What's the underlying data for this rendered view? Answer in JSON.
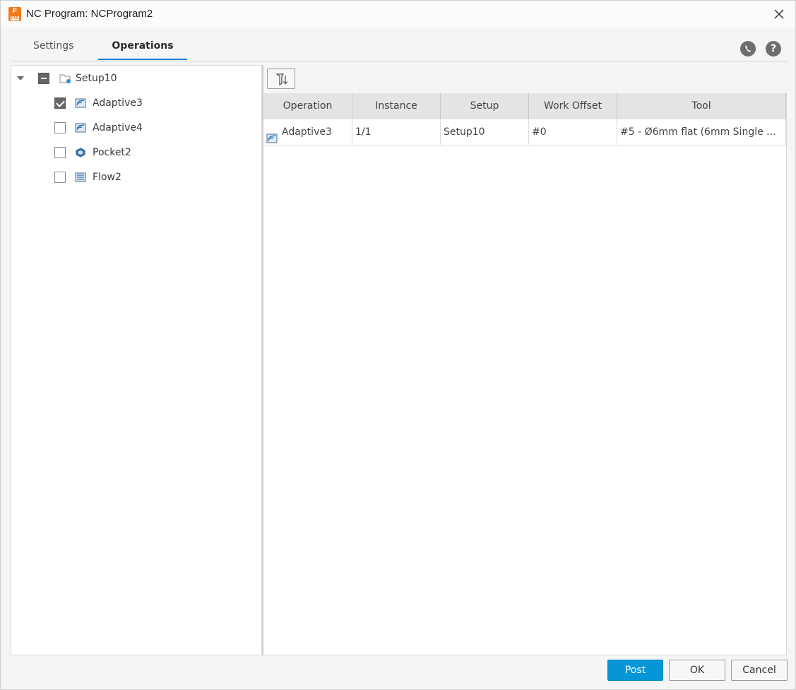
{
  "window": {
    "title": "NC Program: NCProgram2",
    "app_icon_letter": "F",
    "app_icon_sub": "FAB"
  },
  "tabs": [
    {
      "label": "Settings",
      "active": false
    },
    {
      "label": "Operations",
      "active": true
    }
  ],
  "top_icons": [
    "phone-icon",
    "help-icon"
  ],
  "tree": {
    "setup": {
      "label": "Setup10",
      "state": "partial",
      "expanded": true
    },
    "operations": [
      {
        "label": "Adaptive3",
        "checked": true,
        "icon": "adaptive-op-icon"
      },
      {
        "label": "Adaptive4",
        "checked": false,
        "icon": "adaptive-op-icon"
      },
      {
        "label": "Pocket2",
        "checked": false,
        "icon": "pocket-op-icon"
      },
      {
        "label": "Flow2",
        "checked": false,
        "icon": "flow-op-icon"
      }
    ]
  },
  "grid": {
    "columns": [
      "Operation",
      "Instance",
      "Setup",
      "Work Offset",
      "Tool"
    ],
    "rows": [
      {
        "operation": "Adaptive3",
        "instance": "1/1",
        "setup": "Setup10",
        "work_offset": "#0",
        "tool": "#5 - Ø6mm flat (6mm Single ..."
      }
    ]
  },
  "buttons": {
    "post": "Post",
    "ok": "OK",
    "cancel": "Cancel"
  },
  "colors": {
    "accent": "#0696d7",
    "tab_underline": "#1a7fd1",
    "app_icon": "#ee7a1a"
  }
}
